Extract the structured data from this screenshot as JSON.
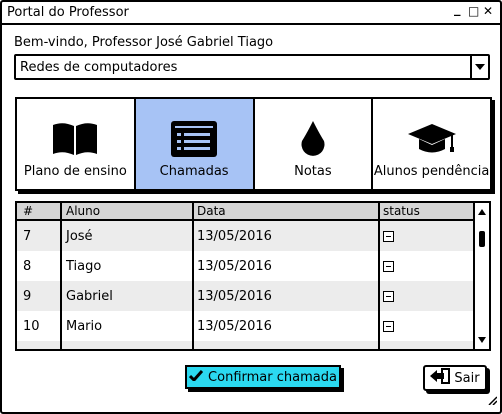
{
  "window": {
    "title": "Portal do Professor",
    "controls": [
      "_",
      "□",
      "✕"
    ]
  },
  "welcome": "Bem-vindo, Professor José Gabriel Tiago",
  "course_select": {
    "value": "Redes de computadores"
  },
  "tiles": [
    {
      "label": "Plano de ensino",
      "icon": "book-icon",
      "active": false
    },
    {
      "label": "Chamadas",
      "icon": "list-icon",
      "active": true
    },
    {
      "label": "Notas",
      "icon": "drop-icon",
      "active": false
    },
    {
      "label": "Alunos pendência",
      "icon": "graduation-cap-icon",
      "active": false
    }
  ],
  "table": {
    "headers": [
      "#",
      "Aluno",
      "Data",
      "status"
    ],
    "rows": [
      {
        "num": "7",
        "aluno": "José",
        "data": "13/05/2016"
      },
      {
        "num": "8",
        "aluno": "Tiago",
        "data": "13/05/2016"
      },
      {
        "num": "9",
        "aluno": "Gabriel",
        "data": "13/05/2016"
      },
      {
        "num": "10",
        "aluno": "Mario",
        "data": "13/05/2016"
      }
    ]
  },
  "buttons": {
    "confirm": "Confirmar chamada",
    "exit": "Sair"
  },
  "colors": {
    "active_tile": "#a7c3f5",
    "confirm_button": "#2bd9f0"
  }
}
